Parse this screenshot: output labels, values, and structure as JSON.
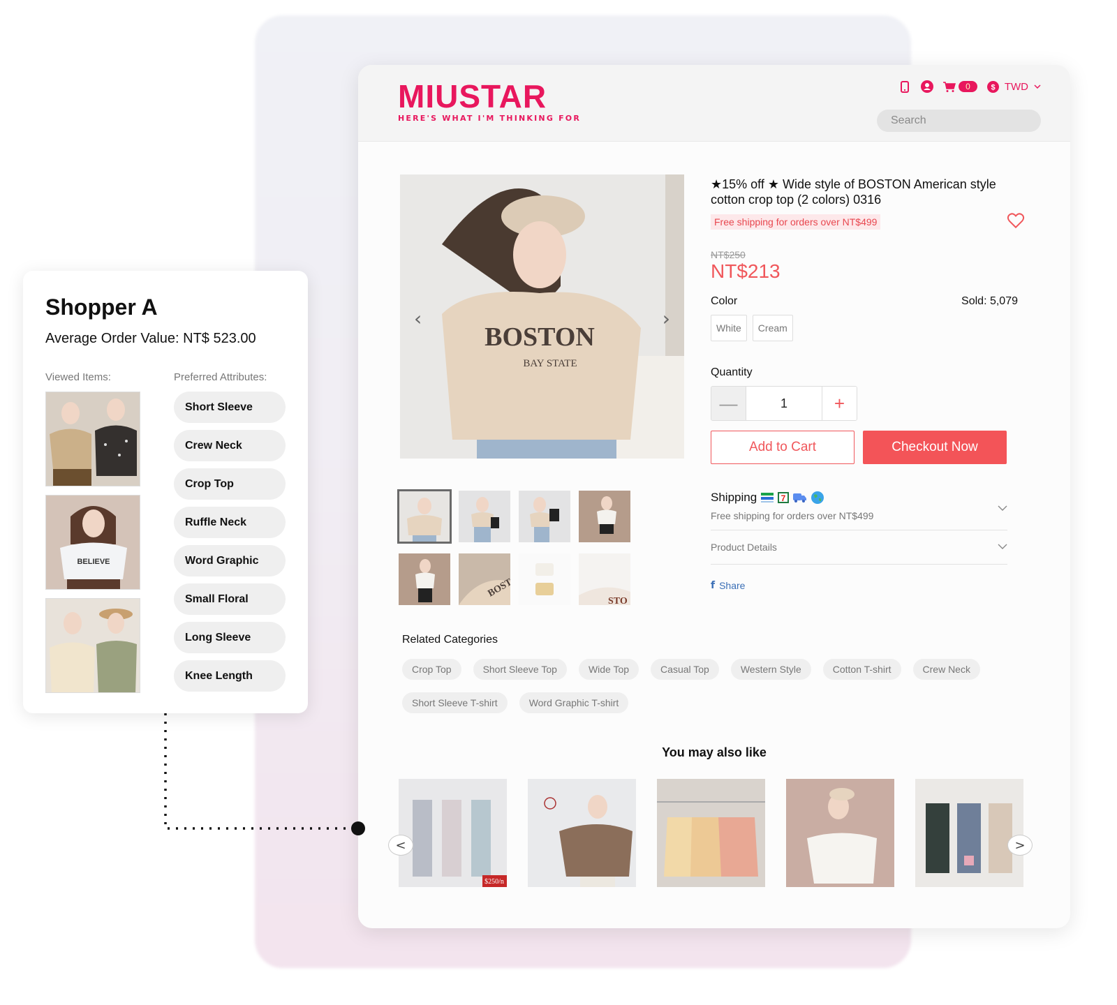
{
  "shopper": {
    "name": "Shopper A",
    "aov_label": "Average Order Value: NT$ 523.00",
    "viewed_label": "Viewed Items:",
    "attributes_label": "Preferred Attributes:",
    "viewed_items": [
      "viewed-item-floral-blouses",
      "viewed-item-believe-tee",
      "viewed-item-pastel-tees"
    ],
    "attributes": [
      "Short Sleeve",
      "Crew Neck",
      "Crop Top",
      "Ruffle Neck",
      "Word Graphic",
      "Small Floral",
      "Long Sleeve",
      "Knee Length"
    ]
  },
  "store": {
    "logo": "MIUSTAR",
    "tagline": "HERE'S WHAT I'M THINKING FOR",
    "cart_count": "0",
    "currency": "TWD",
    "search_placeholder": "Search",
    "colors": {
      "brand": "#e8175d",
      "accent": "#f35458"
    }
  },
  "product": {
    "title": "★15% off ★ Wide style of BOSTON American style cotton crop top (2 colors) 0316",
    "promo": "Free shipping for orders over NT$499",
    "old_price": "NT$250",
    "price": "NT$213",
    "color_label": "Color",
    "sold": "Sold: 5,079",
    "colors": [
      "White",
      "Cream"
    ],
    "quantity_label": "Quantity",
    "quantity": "1",
    "add_to_cart": "Add to Cart",
    "checkout": "Checkout Now",
    "shipping_label": "Shipping",
    "shipping_note": "Free shipping for orders over NT$499",
    "details_label": "Product Details",
    "share_label": "Share",
    "shirt_print": "BOSTON",
    "shirt_sub": "BAY STATE"
  },
  "related": {
    "title": "Related Categories",
    "chips": [
      "Crop Top",
      "Short Sleeve Top",
      "Wide Top",
      "Casual Top",
      "Western Style",
      "Cotton T-shirt",
      "Crew Neck",
      "Short Sleeve T-shirt",
      "Word Graphic T-shirt"
    ]
  },
  "recommendations": {
    "title": "You may also like",
    "price_tag": "$250/n"
  }
}
